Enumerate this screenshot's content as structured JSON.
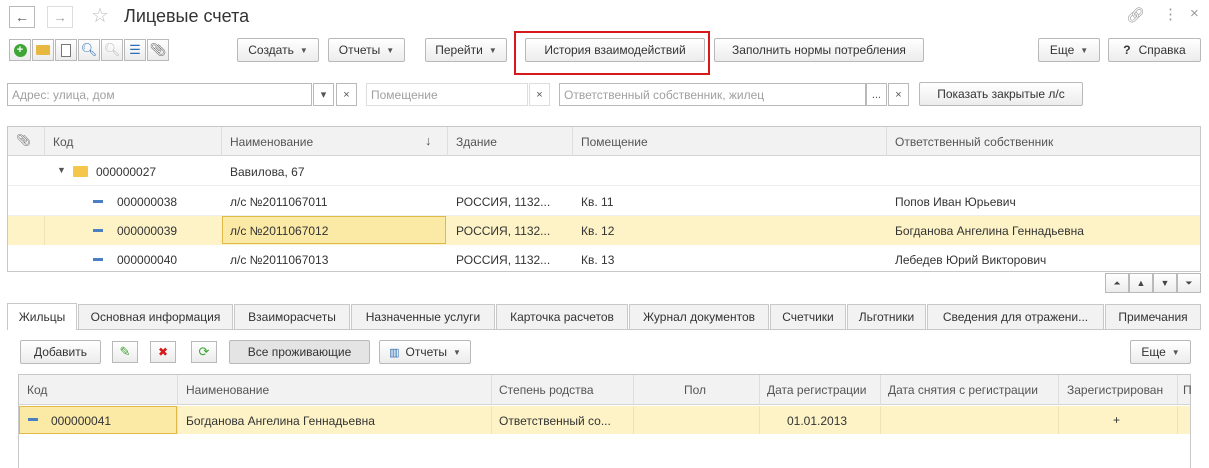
{
  "window": {
    "title": "Лицевые счета"
  },
  "toolbar": {
    "create": "Создать",
    "reports": "Отчеты",
    "goto": "Перейти",
    "history": "История взаимодействий",
    "fill_norms": "Заполнить нормы потребления",
    "more": "Еще",
    "help": "Справка",
    "help_mark": "?"
  },
  "filters": {
    "address_placeholder": "Адрес: улица, дом",
    "room_placeholder": "Помещение",
    "owner_placeholder": "Ответственный собственник, жилец",
    "show_closed": "Показать закрытые л/с",
    "ellipsis": "...",
    "clear": "×",
    "dropdown": "▾"
  },
  "grid": {
    "columns": {
      "code": "Код",
      "name": "Наименование",
      "sort": "↓",
      "building": "Здание",
      "room": "Помещение",
      "owner": "Ответственный собственник"
    },
    "group": {
      "code": "000000027",
      "name": "Вавилова, 67"
    },
    "rows": [
      {
        "code": "000000038",
        "name": "л/с №2011067011",
        "building": "РОССИЯ, 1132...",
        "room": "Кв. 11",
        "owner": "Попов Иван Юрьевич"
      },
      {
        "code": "000000039",
        "name": "л/с №2011067012",
        "building": "РОССИЯ, 1132...",
        "room": "Кв. 12",
        "owner": "Богданова Ангелина Геннадьевна"
      },
      {
        "code": "000000040",
        "name": "л/с №2011067013",
        "building": "РОССИЯ, 1132...",
        "room": "Кв. 13",
        "owner": "Лебедев Юрий Викторович"
      }
    ]
  },
  "tabs": [
    "Жильцы",
    "Основная информация",
    "Взаиморасчеты",
    "Назначенные услуги",
    "Карточка расчетов",
    "Журнал документов",
    "Счетчики",
    "Льготники",
    "Сведения для отражени...",
    "Примечания"
  ],
  "residents": {
    "add": "Добавить",
    "all_living": "Все проживающие",
    "reports": "Отчеты",
    "more": "Еще",
    "columns": {
      "code": "Код",
      "name": "Наименование",
      "relation": "Степень родства",
      "gender": "Пол",
      "reg_date": "Дата регистрации",
      "unreg_date": "Дата снятия с регистрации",
      "registered": "Зарегистрирован",
      "extra": "П"
    },
    "rows": [
      {
        "code": "000000041",
        "name": "Богданова Ангелина Геннадьевна",
        "relation": "Ответственный со...",
        "gender": "",
        "reg_date": "01.01.2013",
        "unreg_date": "",
        "registered": "+"
      }
    ]
  },
  "colors": {
    "highlight": "#fdf3c7",
    "selected_border": "#e0b94a",
    "red_frame": "#d8191c",
    "green": "#3fa535"
  }
}
